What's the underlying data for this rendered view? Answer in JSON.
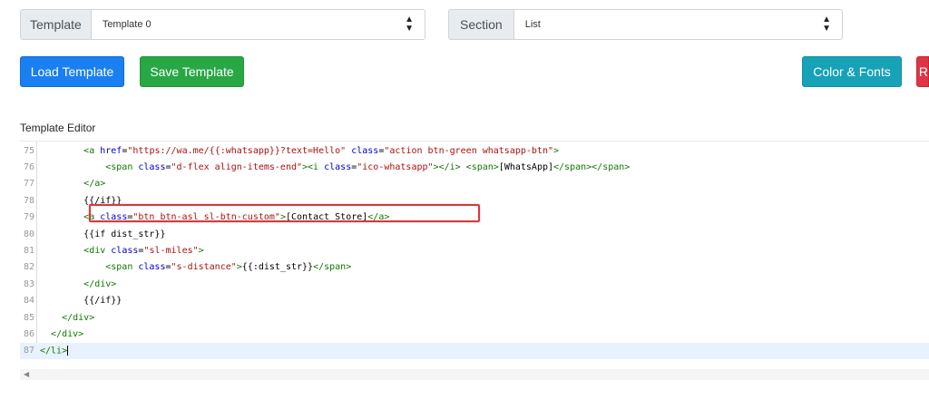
{
  "template_select": {
    "label": "Template",
    "value": "Template 0"
  },
  "section_select": {
    "label": "Section",
    "value": "List"
  },
  "toolbar": {
    "load_label": "Load Template",
    "save_label": "Save Template",
    "color_fonts_label": "Color & Fonts",
    "cut_button_label": "R"
  },
  "editor": {
    "title": "Template Editor",
    "lines": [
      {
        "n": "75",
        "tokens": [
          {
            "t": "        "
          },
          {
            "c": "tag",
            "t": "<a "
          },
          {
            "c": "attr",
            "t": "href"
          },
          {
            "t": "="
          },
          {
            "c": "str",
            "t": "\"https://wa.me/{{:whatsapp}}?text=Hello\""
          },
          {
            "t": " "
          },
          {
            "c": "attr",
            "t": "class"
          },
          {
            "t": "="
          },
          {
            "c": "str",
            "t": "\"action btn-green whatsapp-btn\""
          },
          {
            "c": "tag",
            "t": ">"
          }
        ]
      },
      {
        "n": "76",
        "tokens": [
          {
            "t": "            "
          },
          {
            "c": "tag",
            "t": "<span "
          },
          {
            "c": "attr",
            "t": "class"
          },
          {
            "t": "="
          },
          {
            "c": "str",
            "t": "\"d-flex align-items-end\""
          },
          {
            "c": "tag",
            "t": "><i "
          },
          {
            "c": "attr",
            "t": "class"
          },
          {
            "t": "="
          },
          {
            "c": "str",
            "t": "\"ico-whatsapp\""
          },
          {
            "c": "tag",
            "t": "></i> <span>"
          },
          {
            "t": "[WhatsApp]"
          },
          {
            "c": "tag",
            "t": "</span></span>"
          }
        ]
      },
      {
        "n": "77",
        "tokens": [
          {
            "t": "        "
          },
          {
            "c": "tag",
            "t": "</a>"
          }
        ]
      },
      {
        "n": "78",
        "tokens": [
          {
            "t": "        {{/if}}"
          }
        ]
      },
      {
        "n": "79",
        "tokens": [
          {
            "t": "        "
          },
          {
            "c": "tag",
            "t": "<a "
          },
          {
            "c": "attr",
            "t": "class"
          },
          {
            "t": "="
          },
          {
            "c": "str",
            "t": "\"btn btn-asl sl-btn-custom\""
          },
          {
            "c": "tag",
            "t": ">"
          },
          {
            "t": "[Contact Store]"
          },
          {
            "c": "tag",
            "t": "</a>"
          }
        ]
      },
      {
        "n": "80",
        "tokens": [
          {
            "t": "        {{if dist_str}}"
          }
        ]
      },
      {
        "n": "81",
        "tokens": [
          {
            "t": "        "
          },
          {
            "c": "tag",
            "t": "<div "
          },
          {
            "c": "attr",
            "t": "class"
          },
          {
            "t": "="
          },
          {
            "c": "str",
            "t": "\"sl-miles\""
          },
          {
            "c": "tag",
            "t": ">"
          }
        ]
      },
      {
        "n": "82",
        "tokens": [
          {
            "t": "            "
          },
          {
            "c": "tag",
            "t": "<span "
          },
          {
            "c": "attr",
            "t": "class"
          },
          {
            "t": "="
          },
          {
            "c": "str",
            "t": "\"s-distance\""
          },
          {
            "c": "tag",
            "t": ">"
          },
          {
            "t": "{{:dist_str}}"
          },
          {
            "c": "tag",
            "t": "</span>"
          }
        ]
      },
      {
        "n": "83",
        "tokens": [
          {
            "t": "        "
          },
          {
            "c": "tag",
            "t": "</div>"
          }
        ]
      },
      {
        "n": "84",
        "tokens": [
          {
            "t": "        {{/if}}"
          }
        ]
      },
      {
        "n": "85",
        "tokens": [
          {
            "t": "    "
          },
          {
            "c": "tag",
            "t": "</div>"
          }
        ]
      },
      {
        "n": "86",
        "tokens": [
          {
            "t": "  "
          },
          {
            "c": "tag",
            "t": "</div>"
          }
        ]
      },
      {
        "n": "87",
        "tokens": [
          {
            "c": "tag",
            "t": "</li>"
          }
        ]
      }
    ],
    "active_line": "87",
    "highlighted_line": "79"
  },
  "icons": {
    "select_caret": "up-down-caret-icon",
    "scroll_left": "scroll-left-arrow-icon"
  }
}
